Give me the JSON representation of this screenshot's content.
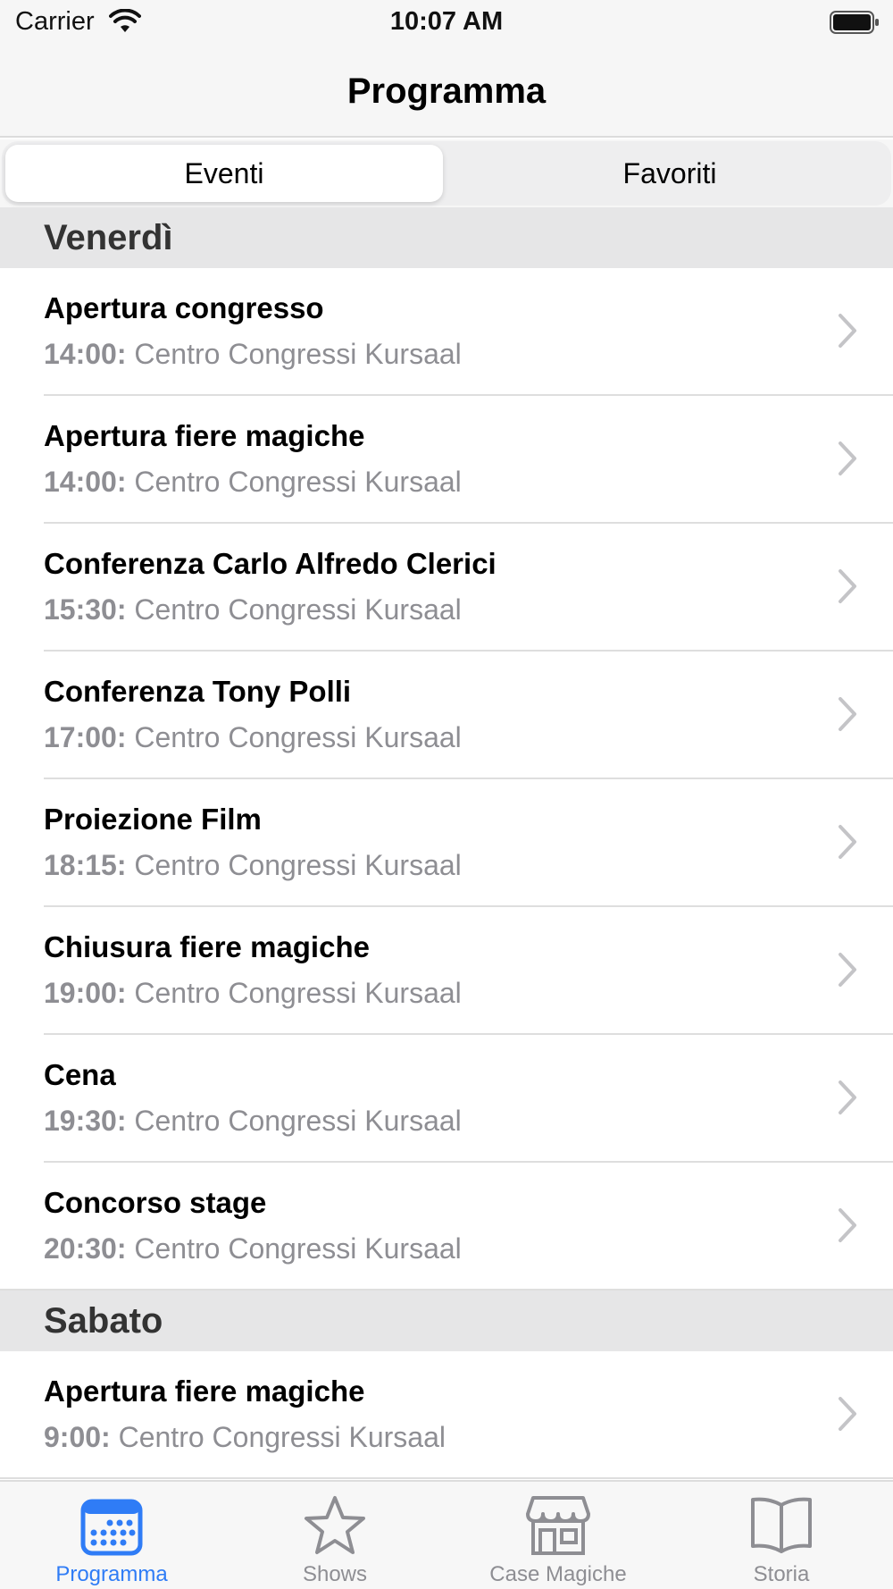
{
  "status_bar": {
    "carrier": "Carrier",
    "time": "10:07 AM"
  },
  "nav": {
    "title": "Programma"
  },
  "segments": {
    "left": "Eventi",
    "right": "Favoriti",
    "selected": "Eventi"
  },
  "sections": [
    {
      "title": "Venerdì",
      "rows": [
        {
          "title": "Apertura congresso",
          "time": "14:00:",
          "place": "Centro Congressi Kursaal"
        },
        {
          "title": "Apertura fiere magiche",
          "time": "14:00:",
          "place": "Centro Congressi Kursaal"
        },
        {
          "title": "Conferenza Carlo Alfredo Clerici",
          "time": "15:30:",
          "place": "Centro Congressi Kursaal"
        },
        {
          "title": "Conferenza Tony Polli",
          "time": "17:00:",
          "place": "Centro Congressi Kursaal"
        },
        {
          "title": "Proiezione Film",
          "time": "18:15:",
          "place": "Centro Congressi Kursaal"
        },
        {
          "title": "Chiusura fiere magiche",
          "time": "19:00:",
          "place": "Centro Congressi Kursaal"
        },
        {
          "title": "Cena",
          "time": "19:30:",
          "place": "Centro Congressi Kursaal"
        },
        {
          "title": "Concorso stage",
          "time": "20:30:",
          "place": "Centro Congressi Kursaal"
        }
      ]
    },
    {
      "title": "Sabato",
      "rows": [
        {
          "title": "Apertura fiere magiche",
          "time": "9:00:",
          "place": "Centro Congressi Kursaal"
        }
      ]
    }
  ],
  "tabs": [
    {
      "label": "Programma",
      "icon": "calendar-icon",
      "active": true
    },
    {
      "label": "Shows",
      "icon": "star-icon",
      "active": false
    },
    {
      "label": "Case Magiche",
      "icon": "storefront-icon",
      "active": false
    },
    {
      "label": "Storia",
      "icon": "book-icon",
      "active": false
    }
  ],
  "colors": {
    "accent": "#2f7cf6",
    "inactive": "#8e8e93",
    "section_bg": "#e6e6e7"
  }
}
